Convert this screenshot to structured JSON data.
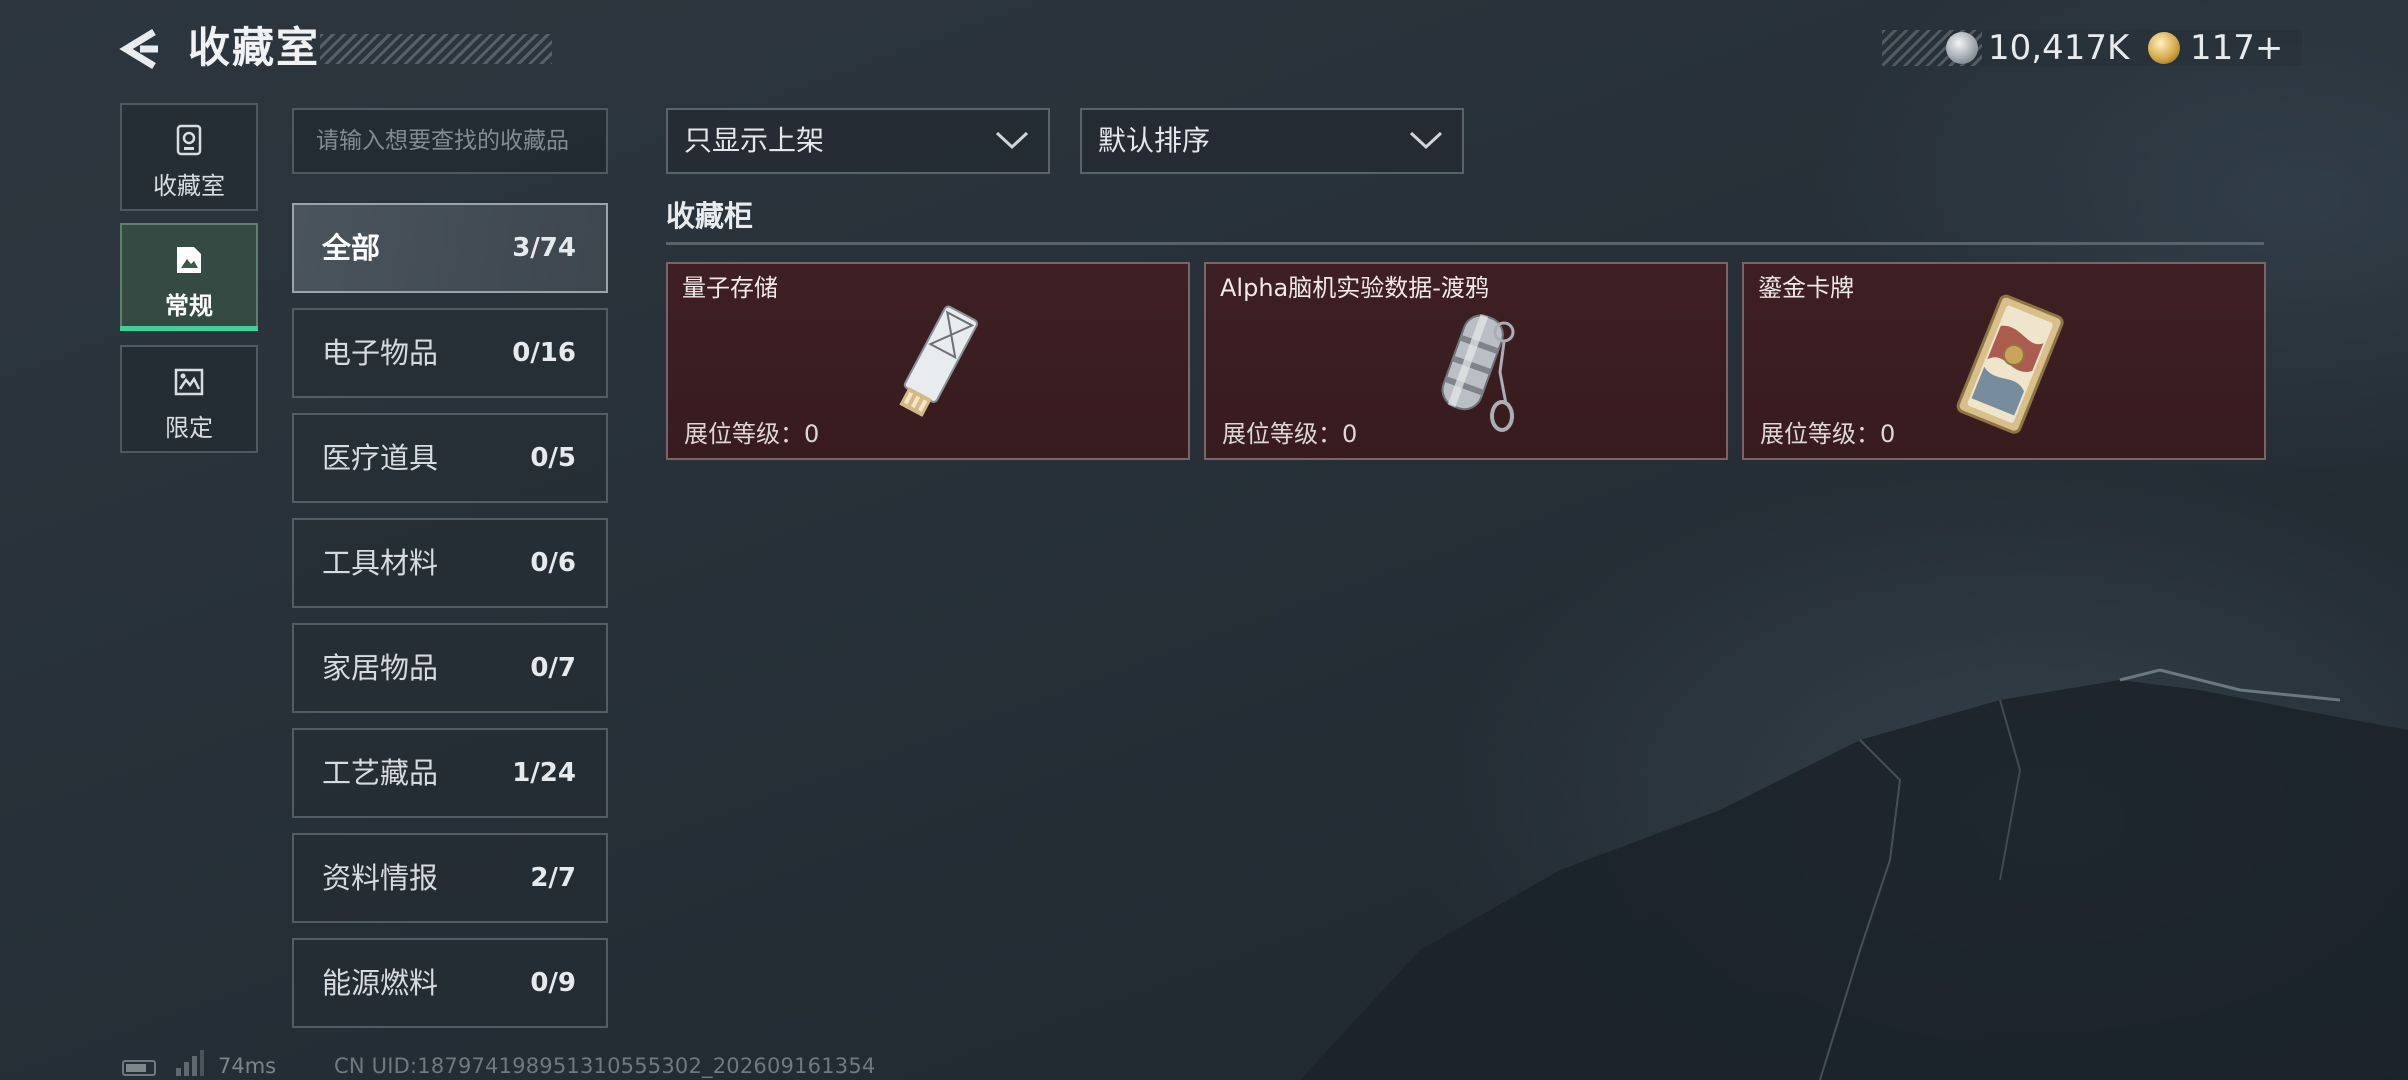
{
  "header": {
    "title": "收藏室",
    "back_icon": "back-arrow-icon",
    "currencies": [
      {
        "icon": "silver-coin-icon",
        "value": "10,417K"
      },
      {
        "icon": "gold-bond-icon",
        "value": "117+"
      }
    ]
  },
  "categories": [
    {
      "label": "收藏室",
      "icon": "vault-icon",
      "active": false
    },
    {
      "label": "常规",
      "icon": "regular-collection-icon",
      "active": true
    },
    {
      "label": "限定",
      "icon": "limited-collection-icon",
      "active": false
    }
  ],
  "search": {
    "placeholder": "请输入想要查找的收藏品",
    "value": ""
  },
  "subcategories": [
    {
      "name": "全部",
      "count": "3/74",
      "active": true
    },
    {
      "name": "电子物品",
      "count": "0/16",
      "active": false
    },
    {
      "name": "医疗道具",
      "count": "0/5",
      "active": false
    },
    {
      "name": "工具材料",
      "count": "0/6",
      "active": false
    },
    {
      "name": "家居物品",
      "count": "0/7",
      "active": false
    },
    {
      "name": "工艺藏品",
      "count": "1/24",
      "active": false
    },
    {
      "name": "资料情报",
      "count": "2/7",
      "active": false
    },
    {
      "name": "能源燃料",
      "count": "0/9",
      "active": false
    }
  ],
  "filters": {
    "shelved": "只显示上架",
    "sort": "默认排序"
  },
  "cabinet": {
    "heading": "收藏柜",
    "items": [
      {
        "name": "量子存储",
        "level": "展位等级：0",
        "art": "usb-drive-icon"
      },
      {
        "name": "Alpha脑机实验数据-渡鸦",
        "level": "展位等级：0",
        "art": "data-capsule-icon"
      },
      {
        "name": "鎏金卡牌",
        "level": "展位等级：0",
        "art": "gilded-card-icon"
      }
    ]
  },
  "status": {
    "ping": "74ms",
    "uid": "CN UID:187974198951310555302_202609161354"
  },
  "colors": {
    "accent": "#3ed29a",
    "card_bg": "#3e2024",
    "card_border": "#7a6467"
  }
}
